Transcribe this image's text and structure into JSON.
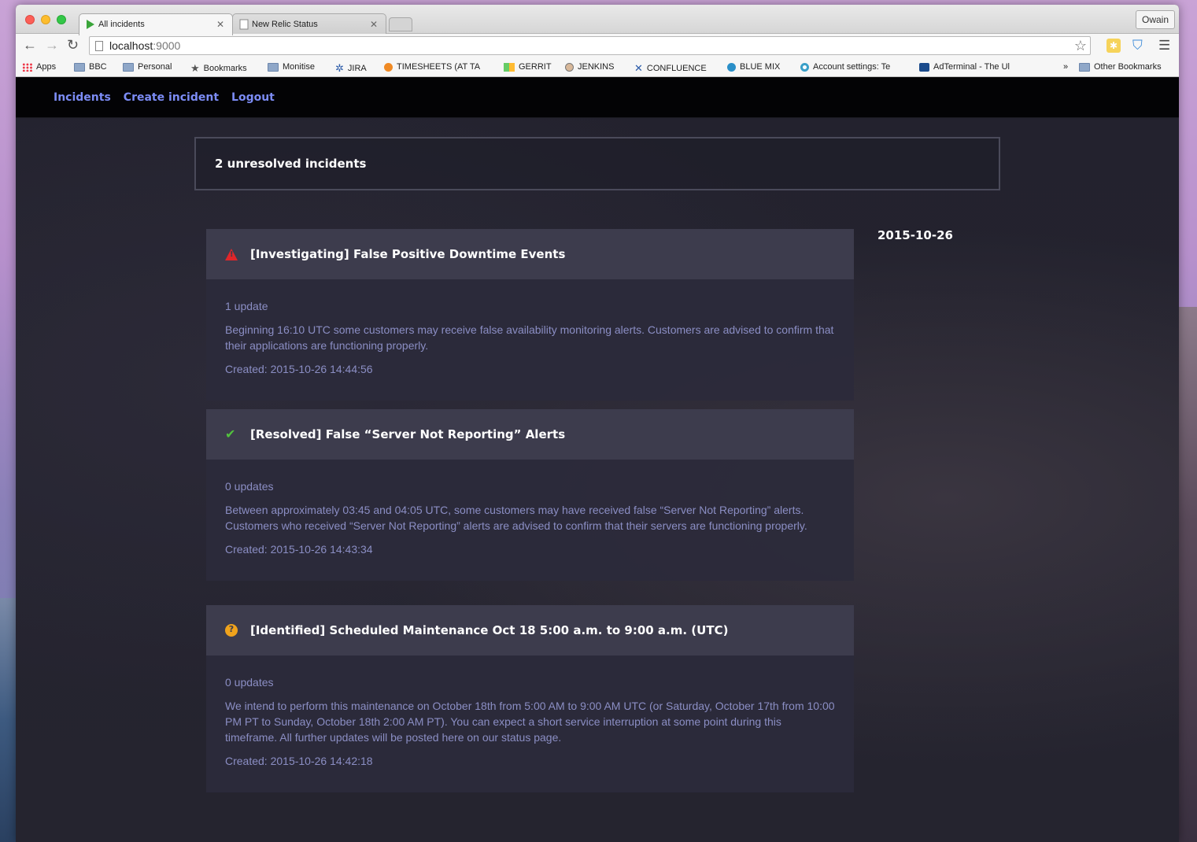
{
  "browser": {
    "tabs": [
      {
        "title": "All incidents",
        "active": true
      },
      {
        "title": "New Relic Status",
        "active": false
      }
    ],
    "profile": "Owain",
    "url_host": "localhost",
    "url_port": ":9000",
    "bookmarks": [
      {
        "label": "Apps",
        "icon": "apps-grid-icon"
      },
      {
        "label": "BBC",
        "icon": "folder-icon"
      },
      {
        "label": "Personal",
        "icon": "folder-icon"
      },
      {
        "label": "Bookmarks",
        "icon": "star-icon"
      },
      {
        "label": "Monitise",
        "icon": "folder-icon"
      },
      {
        "label": "JIRA",
        "icon": "jira-icon"
      },
      {
        "label": "TIMESHEETS (AT TA",
        "icon": "timesheets-icon"
      },
      {
        "label": "GERRIT",
        "icon": "gerrit-icon"
      },
      {
        "label": "JENKINS",
        "icon": "jenkins-icon"
      },
      {
        "label": "CONFLUENCE",
        "icon": "confluence-icon"
      },
      {
        "label": "BLUE MIX",
        "icon": "bluemix-icon"
      },
      {
        "label": "Account settings: Te",
        "icon": "account-icon"
      },
      {
        "label": "AdTerminal - The Ul",
        "icon": "adterminal-icon"
      },
      {
        "label": "»",
        "icon": "overflow-icon"
      },
      {
        "label": "Other Bookmarks",
        "icon": "folder-icon"
      }
    ]
  },
  "nav": {
    "incidents": "Incidents",
    "create": "Create incident",
    "logout": "Logout"
  },
  "summary": "2 unresolved incidents",
  "date": "2015-10-26",
  "incidents": [
    {
      "title": "[Investigating] False Positive Downtime Events",
      "status_icon": "warning-icon",
      "updates": "1 update",
      "description": "Beginning 16:10 UTC some customers may receive false availability monitoring alerts. Customers are advised to confirm that their applications are functioning properly.",
      "created": "Created: 2015-10-26 14:44:56"
    },
    {
      "title": "[Resolved] False “Server Not Reporting” Alerts",
      "status_icon": "check-icon",
      "updates": "0 updates",
      "description": "Between approximately 03:45 and 04:05 UTC, some customers may have received false “Server Not Reporting” alerts. Customers who received “Server Not Reporting” alerts are advised to confirm that their servers are functioning properly.",
      "created": "Created: 2015-10-26 14:43:34"
    },
    {
      "title": "[Identified] Scheduled Maintenance Oct 18 5:00 a.m. to 9:00 a.m. (UTC)",
      "status_icon": "question-icon",
      "updates": "0 updates",
      "description": "We intend to perform this maintenance on October 18th from 5:00 AM to 9:00 AM UTC (or Saturday, October 17th from 10:00 PM PT to Sunday, October 18th 2:00 AM PT). You can expect a short service interruption at some point during this timeframe. All further updates will be posted here on our status page.",
      "created": "Created: 2015-10-26 14:42:18"
    }
  ],
  "colors": {
    "nav_link": "#7c8cf5",
    "body_text": "#8b8ec4",
    "warning": "#e0262a",
    "resolved": "#52c23e",
    "identified": "#f0a31c"
  }
}
